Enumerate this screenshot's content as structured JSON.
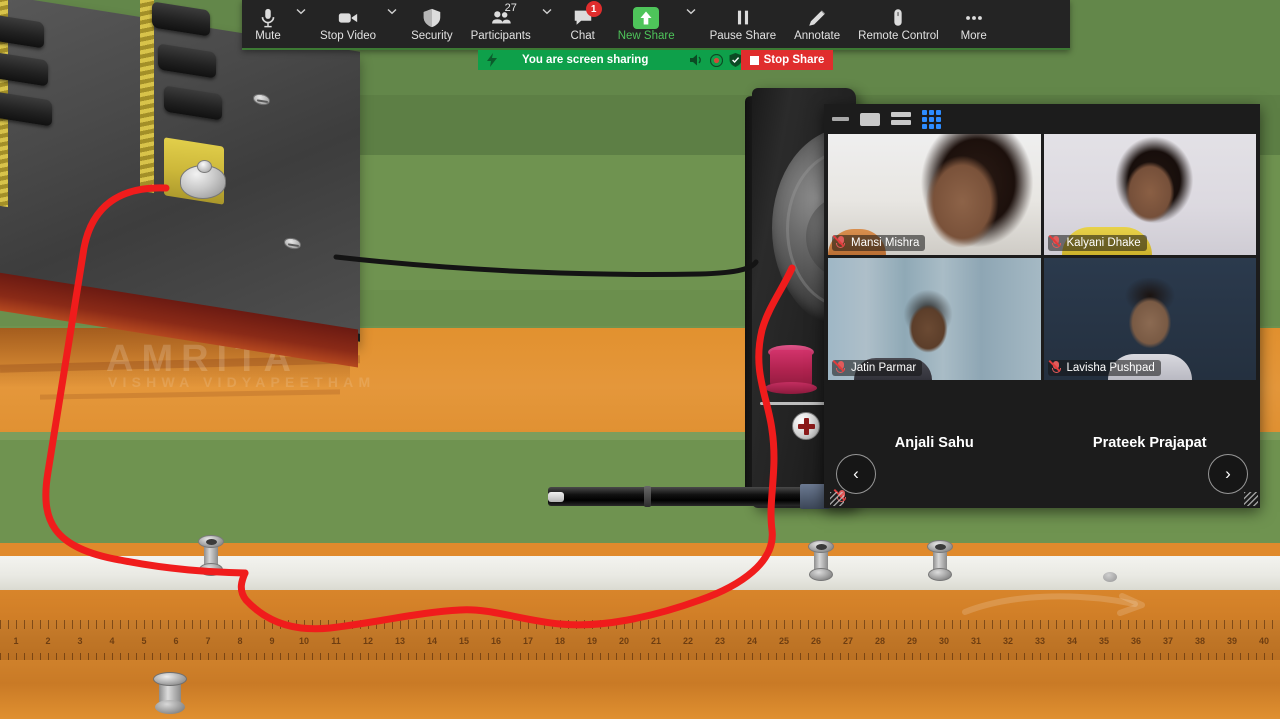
{
  "meeting_toolbar": {
    "items": [
      {
        "label": "Mute",
        "icon": "microphone-icon",
        "has_caret": true,
        "accent": ""
      },
      {
        "label": "Stop Video",
        "icon": "video-camera-icon",
        "has_caret": true,
        "accent": ""
      },
      {
        "label": "Security",
        "icon": "shield-icon",
        "has_caret": false,
        "accent": ""
      },
      {
        "label": "Participants",
        "icon": "participants-icon",
        "has_caret": true,
        "accent": "",
        "count": "27"
      },
      {
        "label": "Chat",
        "icon": "chat-bubble-icon",
        "has_caret": false,
        "accent": "",
        "badge": "1"
      },
      {
        "label": "New Share",
        "icon": "share-screen-up-arrow-icon",
        "has_caret": true,
        "accent": "#4ec45a"
      },
      {
        "label": "Pause Share",
        "icon": "pause-icon",
        "has_caret": false,
        "accent": ""
      },
      {
        "label": "Annotate",
        "icon": "pencil-icon",
        "has_caret": false,
        "accent": ""
      },
      {
        "label": "Remote Control",
        "icon": "mouse-icon",
        "has_caret": false,
        "accent": ""
      },
      {
        "label": "More",
        "icon": "ellipsis-icon",
        "has_caret": false,
        "accent": ""
      }
    ]
  },
  "share_bar": {
    "status_text": "You are screen sharing",
    "stop_label": "Stop Share",
    "bg_color": "#0ea04a",
    "stop_color": "#e02d2d"
  },
  "video_panel": {
    "window_controls": [
      {
        "name": "minimize",
        "icon": "minimize-icon"
      },
      {
        "name": "maximize",
        "icon": "maximize-icon"
      },
      {
        "name": "speaker-view",
        "icon": "speaker-view-icon"
      },
      {
        "name": "gallery-view",
        "icon": "gallery-view-icon",
        "active": true
      }
    ],
    "active_view": "gallery-view",
    "accent_color": "#2d8cff",
    "participants": [
      {
        "name": "Mansi Mishra",
        "muted": true,
        "video_on": true,
        "style": "ph-mansi",
        "label_pos": "bottom-left"
      },
      {
        "name": "Kalyani Dhake",
        "muted": true,
        "video_on": true,
        "style": "ph-kalyani",
        "label_pos": "bottom-left"
      },
      {
        "name": "Jatin Parmar",
        "muted": true,
        "video_on": true,
        "style": "ph-jatin",
        "label_pos": "bottom-left"
      },
      {
        "name": "Lavisha Pushpad",
        "muted": true,
        "video_on": true,
        "style": "ph-lavisha",
        "label_pos": "bottom-left"
      },
      {
        "name": "Anjali Sahu",
        "muted": true,
        "video_on": false,
        "style": "",
        "label_pos": "center"
      },
      {
        "name": "Prateek Prajapat",
        "muted": true,
        "video_on": false,
        "style": "",
        "label_pos": "center"
      }
    ],
    "nav": {
      "prev": "‹",
      "next": "›"
    }
  },
  "simulation": {
    "watermark_line1": "AMRITA",
    "watermark_line2": "VISHWA VIDYAPEETHAM",
    "ruler_numbers": [
      "1",
      "2",
      "3",
      "4",
      "5",
      "6",
      "7",
      "8",
      "9",
      "10",
      "11",
      "12",
      "13",
      "14",
      "15",
      "16",
      "17",
      "18",
      "19",
      "20",
      "21",
      "22",
      "23",
      "24",
      "25",
      "26",
      "27",
      "28",
      "29",
      "30",
      "31",
      "32",
      "33",
      "34",
      "35",
      "36",
      "37",
      "38",
      "39",
      "40"
    ],
    "colors": {
      "wire": "#f01c1c",
      "table": "#e2912f",
      "background": "#6f9350",
      "panel": "#4a4a4a",
      "knob": "#b0234f"
    }
  }
}
